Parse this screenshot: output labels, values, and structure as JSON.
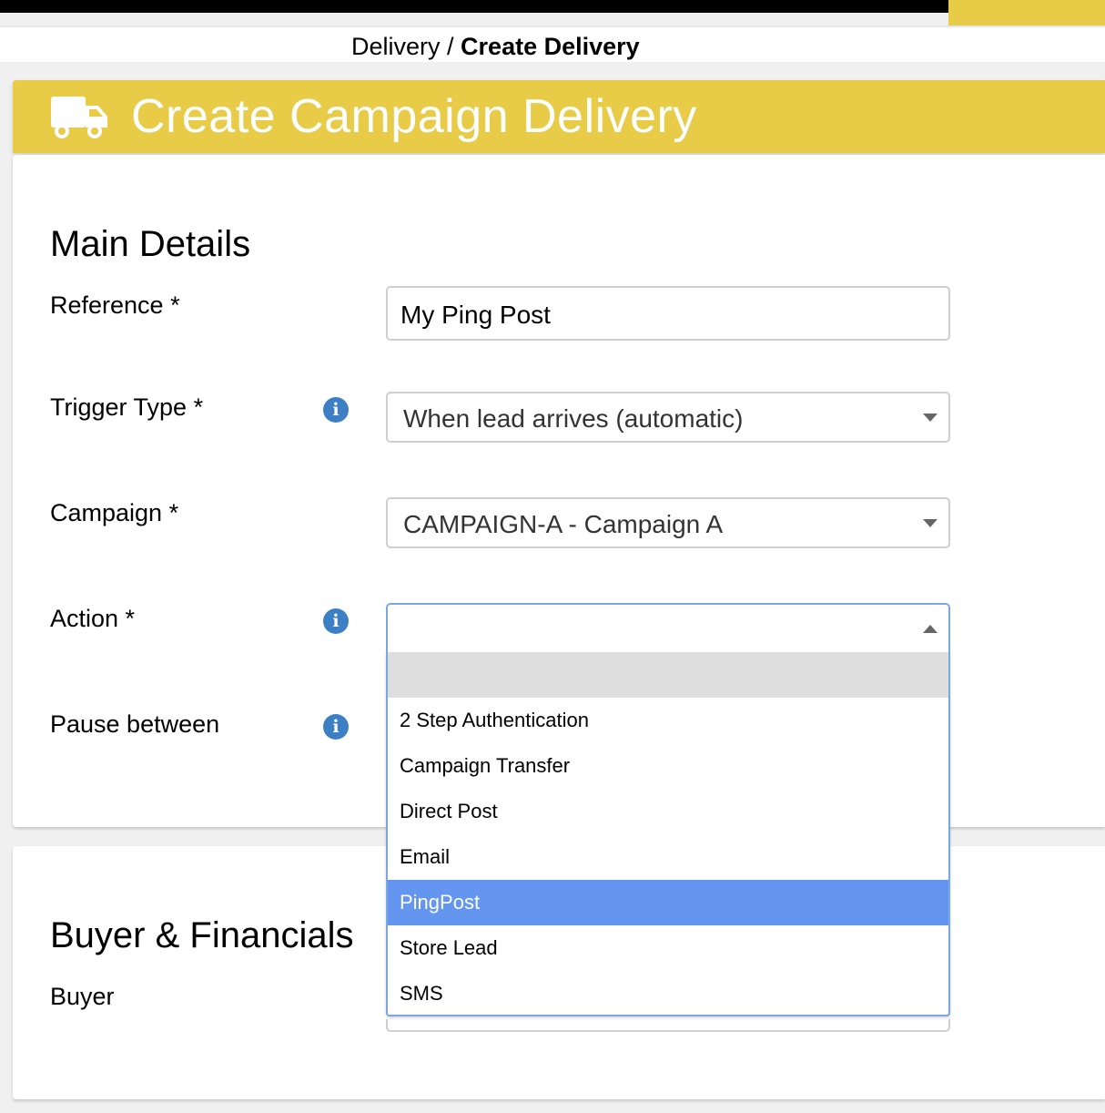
{
  "breadcrumb": {
    "parent": "Delivery",
    "separator": " / ",
    "current": "Create Delivery"
  },
  "header": {
    "title": "Create Campaign Delivery",
    "icon": "truck-icon"
  },
  "main_details": {
    "title": "Main Details",
    "reference": {
      "label": "Reference *",
      "value": "My Ping Post"
    },
    "trigger_type": {
      "label": "Trigger Type *",
      "value": "When lead arrives (automatic)"
    },
    "campaign": {
      "label": "Campaign *",
      "value": "CAMPAIGN-A - Campaign A"
    },
    "action": {
      "label": "Action *",
      "value": ""
    },
    "pause_between": {
      "label": "Pause between"
    }
  },
  "action_dropdown": {
    "options": [
      {
        "label": "2 Step Authentication"
      },
      {
        "label": "Campaign Transfer"
      },
      {
        "label": "Direct Post"
      },
      {
        "label": "Email"
      },
      {
        "label": "PingPost"
      },
      {
        "label": "Store Lead"
      },
      {
        "label": "SMS"
      }
    ],
    "highlighted": "PingPost"
  },
  "buyer_financials": {
    "title": "Buyer & Financials",
    "buyer": {
      "label": "Buyer"
    }
  },
  "colors": {
    "accent_yellow": "#e8cb47",
    "info_blue": "#3d7fc4",
    "highlight_blue": "#6496f0"
  }
}
